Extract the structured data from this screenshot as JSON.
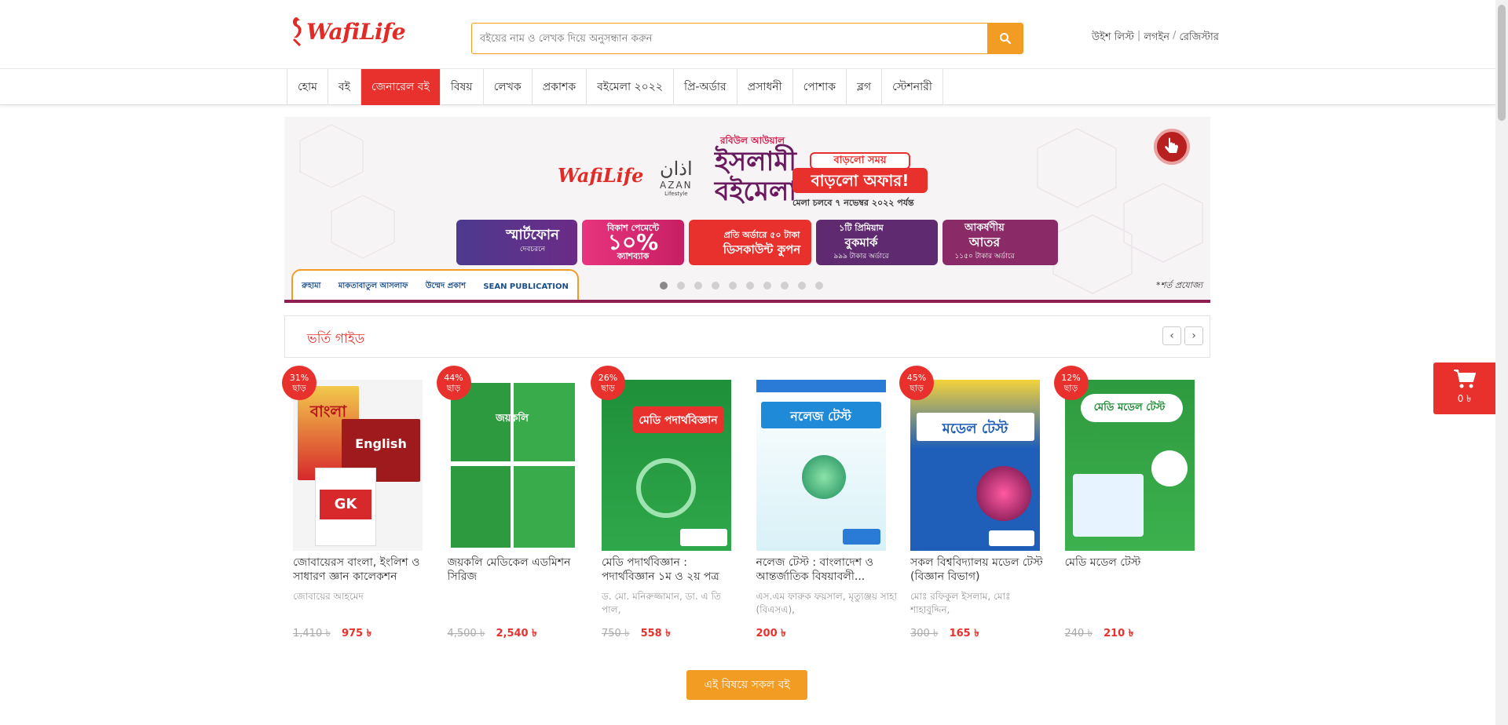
{
  "header": {
    "logo_text": "WafiLife",
    "search_placeholder": "বইয়ের নাম ও লেখক দিয়ে অনুসন্ধান করুন",
    "wishlist": "উইশ লিস্ট",
    "login": "লগইন",
    "register": "রেজিস্টার",
    "separator_1": "|",
    "separator_2": "/"
  },
  "nav": {
    "items": [
      "হোম",
      "বই",
      "জেনারেল বই",
      "বিষয়",
      "লেখক",
      "প্রকাশক",
      "বইমেলা ২০২২",
      "প্রি-অর্ডার",
      "প্রসাধনী",
      "পোশাক",
      "ব্লগ",
      "স্টেশনারী"
    ],
    "active_index": 2
  },
  "banner": {
    "logo_text": "WafiLife",
    "azan_ar": "اذان",
    "azan_en": "AZAN",
    "azan_sub": "Lifestyle",
    "title_small": "রবিউল আউয়াল",
    "title": "ইসলামী বইমেলা",
    "offer_top": "বাড়লো সময়",
    "offer_main": "বাড়লো অফার!",
    "offer_date": "মেলা চলবে ৭ নভেম্বর ২০২২ পর্যন্ত",
    "tiles": [
      {
        "main": "স্মার্টফোন",
        "sub": "দেবচরনে"
      },
      {
        "small": "বিকাশ পেমেন্টে",
        "main": "১০%",
        "sub": "ক্যাশব্যাক"
      },
      {
        "small": "প্রতি অর্ডারে ৫০ টাকা",
        "main": "ডিসকাউন্ট কুপন"
      },
      {
        "small": "১টি প্রিমিয়াম",
        "main": "বুকমার্ক",
        "sub": "৯৯৯ টাকার অর্ডারে"
      },
      {
        "small": "আকর্ষণীয়",
        "main": "আতর",
        "sub": "১১৫০ টাকার অর্ডারে"
      }
    ],
    "publishers": [
      "রুহামা",
      "মাকতাবাতুল আসলাফ",
      "উম্মেদ প্রকাশ",
      "SEAN PUBLICATION"
    ],
    "condition": "*শর্ত প্রযোজ্য",
    "slide_count": 10,
    "active_slide": 0
  },
  "section": {
    "title": "ভর্তি গাইড",
    "prev": "‹",
    "next": "›"
  },
  "products": [
    {
      "discount": "31%",
      "off": "ছাড়",
      "title": "জোবায়েরস বাংলা, ইংলিশ ও সাধারণ জ্ঞান কালেকশন",
      "author": "জোবায়ের আহমেদ",
      "old_price": "1,410 ৳",
      "price": "975 ৳"
    },
    {
      "discount": "44%",
      "off": "ছাড়",
      "title": "জয়কলি মেডিকেল এডমিশন সিরিজ",
      "author": "",
      "old_price": "4,500 ৳",
      "price": "2,540 ৳"
    },
    {
      "discount": "26%",
      "off": "ছাড়",
      "title": "মেডি পদার্থবিজ্ঞান : পদার্থবিজ্ঞান ১ম ও ২য় পত্র",
      "author": "ড. মো. মনিরুজ্জামান, ডা. এ তি পাল,",
      "old_price": "750 ৳",
      "price": "558 ৳"
    },
    {
      "discount": "",
      "off": "",
      "title": "নলেজ টেস্ট : বাংলাদেশ ও আন্তর্জাতিক বিষয়াবলী...",
      "author": "এস.এম ফারুক ফয়সাল, মৃত্যুঞ্জয় সাহা (বিএসএ),",
      "old_price": "",
      "price": "200 ৳"
    },
    {
      "discount": "45%",
      "off": "ছাড়",
      "title": "সকল বিশ্ববিদ্যালয় মডেল টেস্ট (বিজ্ঞান বিভাগ)",
      "author": "মোঃ রফিকুল ইসলাম, মোঃ শাহাবুদ্দিন,",
      "old_price": "300 ৳",
      "price": "165 ৳"
    },
    {
      "discount": "12%",
      "off": "ছাড়",
      "title": "মেডি মডেল টেস্ট",
      "author": "",
      "old_price": "240 ৳",
      "price": "210 ৳"
    }
  ],
  "covers": [
    {
      "label": "বাংলা",
      "label2": "English",
      "label3": "GK"
    },
    {
      "label": "জয়কলি"
    },
    {
      "label": "মেডি পদার্থবিজ্ঞান"
    },
    {
      "label": "নলেজ টেস্ট"
    },
    {
      "label": "মডেল টেস্ট"
    },
    {
      "label": "মেডি মডেল টেস্ট"
    }
  ],
  "all_button": "এই বিষয়ে সকল বই",
  "cart": {
    "count": "0 ৳"
  },
  "colors": {
    "brand_red": "#e8312d",
    "accent_orange": "#f39c24",
    "banner_purple": "#6a1b5f"
  }
}
